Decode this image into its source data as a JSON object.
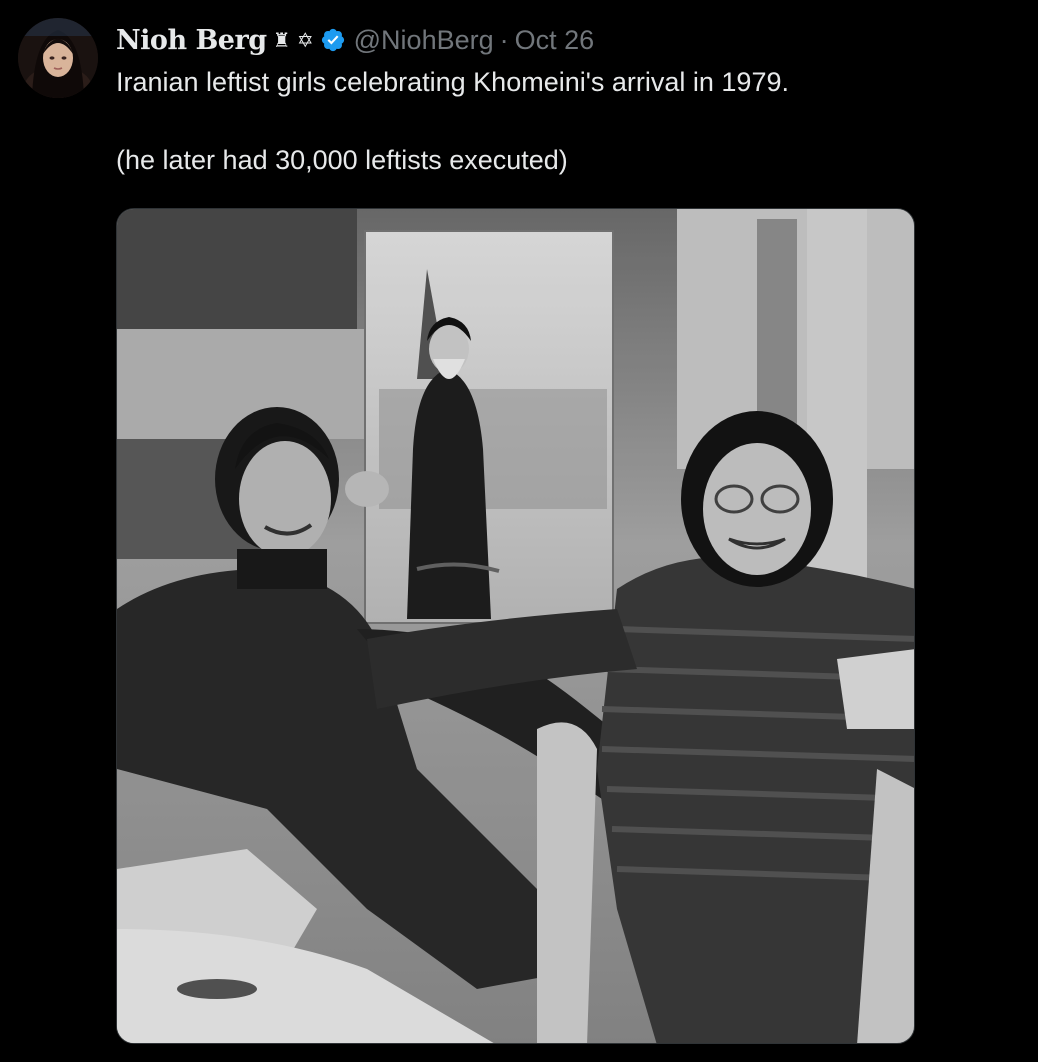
{
  "tweet": {
    "author": {
      "display_name": "Nioh Berg",
      "emojis": "♜ ✡",
      "handle": "@NiohBerg",
      "verified": true,
      "avatar_icon": "avatar-photo"
    },
    "separator": "·",
    "date": "Oct 26",
    "text_line1": "Iranian leftist girls celebrating Khomeini's arrival in 1979.",
    "text_line2": "(he later had 30,000 leftists executed)",
    "media": {
      "type": "black-and-white photo",
      "icon": "photo"
    }
  },
  "colors": {
    "background": "#000000",
    "text": "#e7e9ea",
    "secondary_text": "#71767b",
    "verified_badge": "#1d9bf0"
  }
}
